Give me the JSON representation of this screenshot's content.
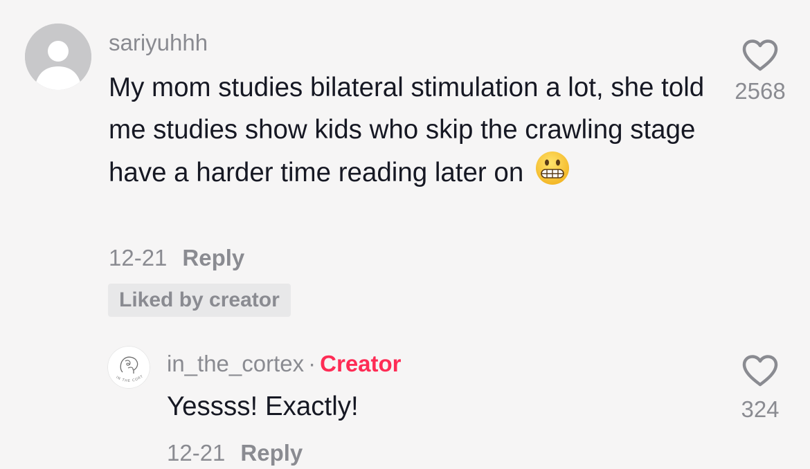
{
  "comment": {
    "username": "sariyuhhh",
    "text": "My mom studies bilateral stimulation a lot, she told me studies show kids who skip the crawling stage have a harder time reading later on",
    "emoji": "grimacing-face-emoji",
    "date": "12-21",
    "reply_label": "Reply",
    "liked_by_creator_label": "Liked by creator",
    "like_icon": "heart-outline-icon",
    "like_count": "2568",
    "avatar_icon": "default-user-avatar-icon"
  },
  "reply": {
    "username": "in_the_cortex",
    "separator": "·",
    "badge": "Creator",
    "text": "Yessss! Exactly!",
    "date": "12-21",
    "reply_label": "Reply",
    "like_icon": "heart-outline-icon",
    "like_count": "324",
    "avatar_logo_text": "IN THE CORTEX"
  },
  "colors": {
    "background": "#f6f5f5",
    "primary_text": "#161823",
    "secondary_text": "#8a8b91",
    "creator_accent": "#fe2c55",
    "chip_background": "#e8e8e9"
  }
}
